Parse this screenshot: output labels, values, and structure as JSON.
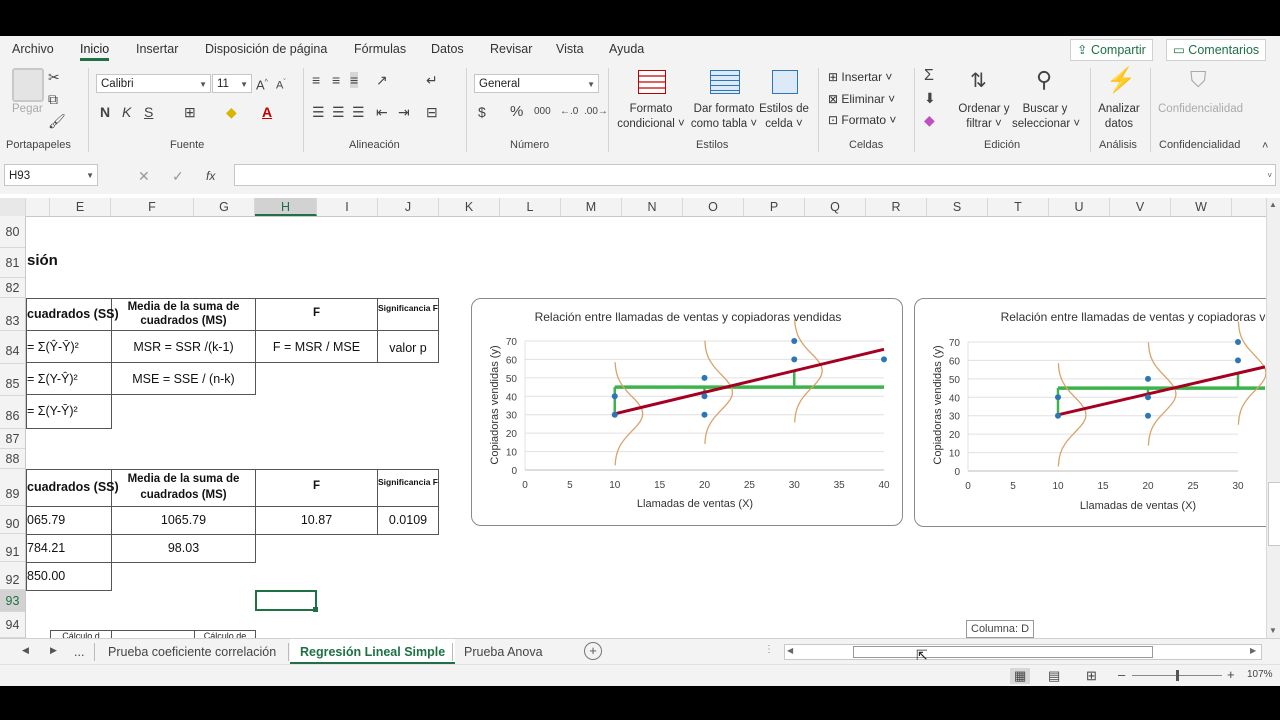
{
  "menu": {
    "tabs": [
      "Archivo",
      "Inicio",
      "Insertar",
      "Disposición de página",
      "Fórmulas",
      "Datos",
      "Revisar",
      "Vista",
      "Ayuda"
    ],
    "share": "Compartir",
    "comments": "Comentarios"
  },
  "ribbon": {
    "paste": "Pegar",
    "font_name": "Calibri",
    "font_size": "11",
    "number_format": "General",
    "bold": "N",
    "italic": "K",
    "underline": "S",
    "cond_format_1": "Formato",
    "cond_format_2": "condicional",
    "table_format_1": "Dar formato",
    "table_format_2": "como tabla",
    "cell_styles_1": "Estilos de",
    "cell_styles_2": "celda",
    "insert": "Insertar",
    "delete": "Eliminar",
    "format": "Formato",
    "sort_1": "Ordenar y",
    "sort_2": "filtrar",
    "find_1": "Buscar y",
    "find_2": "seleccionar",
    "analyze_1": "Analizar",
    "analyze_2": "datos",
    "confidential_btn": "Confidencialidad",
    "groups": {
      "clipboard": "Portapapeles",
      "font": "Fuente",
      "alignment": "Alineación",
      "number": "Número",
      "styles": "Estilos",
      "cells": "Celdas",
      "editing": "Edición",
      "analysis": "Análisis",
      "confidential": "Confidencialidad"
    }
  },
  "formula_bar": {
    "name_box": "H93",
    "fx": "fx",
    "content": ""
  },
  "grid": {
    "columns": [
      "E",
      "F",
      "G",
      "H",
      "I",
      "J",
      "K",
      "L",
      "M",
      "N",
      "O",
      "P",
      "Q",
      "R",
      "S",
      "T",
      "U",
      "V",
      "W"
    ],
    "selected_column": "H",
    "rows": [
      "80",
      "81",
      "82",
      "83",
      "84",
      "85",
      "86",
      "87",
      "88",
      "89",
      "90",
      "91",
      "92",
      "93",
      "94"
    ],
    "selected_row": "93",
    "heading": "sión",
    "table1": {
      "h_ss": "cuadrados (SS)",
      "h_ms": "Media de la suma de cuadrados (MS)",
      "h_f": "F",
      "h_sig": "Significancia F",
      "r1_ss": "= Σ(Ŷ-Ȳ)²",
      "r1_ms": "MSR = SSR /(k-1)",
      "r1_f": "F = MSR / MSE",
      "r1_sig": "valor p",
      "r2_ss": "= Σ(Y-Ŷ)²",
      "r2_ms": "MSE = SSE / (n-k)",
      "r3_ss": "= Σ(Y-Ȳ)²"
    },
    "table2": {
      "h_ss": "cuadrados (SS)",
      "h_ms": "Media de la suma de cuadrados (MS)",
      "h_f": "F",
      "h_sig": "Significancia F",
      "r1_ss": "065.79",
      "r1_ms": "1065.79",
      "r1_f": "10.87",
      "r1_sig": "0.0109",
      "r2_ss": "784.21",
      "r2_ms": "98.03",
      "r3_ss": "850.00"
    },
    "row94_fragments": [
      "Cálculo d",
      "Cálculo de"
    ]
  },
  "chart_data": [
    {
      "type": "scatter",
      "title": "Relación entre llamadas de ventas y copiadoras vendidas",
      "xlabel": "Llamadas de ventas (X)",
      "ylabel": "Copiadoras vendidas (y)",
      "xlim": [
        0,
        40
      ],
      "ylim": [
        0,
        70
      ],
      "x_ticks": [
        "0",
        "5",
        "10",
        "15",
        "20",
        "25",
        "30",
        "35",
        "40"
      ],
      "y_ticks": [
        "0",
        "10",
        "20",
        "30",
        "40",
        "50",
        "60",
        "70"
      ],
      "points": [
        [
          10,
          30
        ],
        [
          10,
          40
        ],
        [
          20,
          30
        ],
        [
          20,
          40
        ],
        [
          20,
          50
        ],
        [
          30,
          60
        ],
        [
          30,
          70
        ],
        [
          40,
          60
        ]
      ],
      "regression_line": [
        [
          10,
          30.5
        ],
        [
          40,
          65.5
        ]
      ],
      "mean_line": {
        "y": 45,
        "x": [
          10,
          40
        ]
      },
      "colors": {
        "points": "#2e75b6",
        "regression": "#a50021",
        "mean": "#3cb44b",
        "curves": "#d9a36a"
      }
    },
    {
      "type": "scatter",
      "title": "Relación entre llamadas de ventas y copiadoras vend",
      "xlabel": "Llamadas de ventas (X)",
      "ylabel": "Copiadoras vendidas (y)",
      "xlim": [
        0,
        30
      ],
      "ylim": [
        0,
        70
      ],
      "x_ticks": [
        "0",
        "5",
        "10",
        "15",
        "20",
        "25",
        "30"
      ],
      "y_ticks": [
        "0",
        "10",
        "20",
        "30",
        "40",
        "50",
        "60",
        "70"
      ],
      "points": [
        [
          10,
          30
        ],
        [
          10,
          40
        ],
        [
          20,
          30
        ],
        [
          20,
          40
        ],
        [
          20,
          50
        ],
        [
          30,
          60
        ],
        [
          30,
          70
        ]
      ],
      "regression_line": [
        [
          10,
          30.5
        ],
        [
          33,
          56.5
        ]
      ],
      "mean_line": {
        "y": 45,
        "x": [
          10,
          33
        ]
      },
      "colors": {
        "points": "#2e75b6",
        "regression": "#a50021",
        "mean": "#3cb44b",
        "curves": "#d9a36a"
      }
    }
  ],
  "sheets": {
    "nav_dots": "...",
    "tabs": [
      "Prueba coeficiente correlación",
      "Regresión Lineal Simple",
      "Prueba Anova"
    ],
    "active": "Regresión Lineal Simple",
    "tooltip": "Columna: D"
  },
  "status": {
    "zoom": "107%"
  }
}
